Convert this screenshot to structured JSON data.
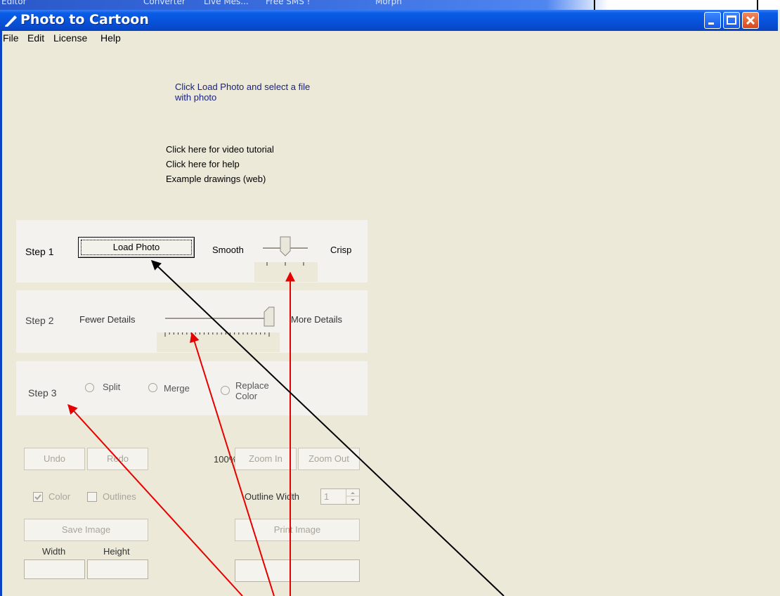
{
  "taskbar": {
    "items": [
      "Editor",
      "Converter",
      "Live Mes...",
      "Free SMS !",
      "Morph"
    ]
  },
  "window": {
    "title": "Photo to Cartoon",
    "menu": [
      "File",
      "Edit",
      "License",
      "Help"
    ]
  },
  "instructions": {
    "load_hint_line1": "Click Load Photo and select a file",
    "load_hint_line2": "with photo",
    "video_link": "Click here for video tutorial",
    "help_link": "Click here for help",
    "examples_link": "Example drawings (web)"
  },
  "step1": {
    "label": "Step 1",
    "button": "Load Photo",
    "smooth_label": "Smooth",
    "crisp_label": "Crisp",
    "slider_value": 0.5
  },
  "step2": {
    "label": "Step 2",
    "fewer_label": "Fewer Details",
    "more_label": "More Details",
    "slider_value": 1.0
  },
  "step3": {
    "label": "Step 3",
    "options": [
      "Split",
      "Merge",
      "Replace Color"
    ]
  },
  "toolbar": {
    "undo": "Undo",
    "redo": "Redo",
    "zoom_level": "100%",
    "zoom_in": "Zoom In",
    "zoom_out": "Zoom Out",
    "color_checkbox": "Color",
    "outlines_checkbox": "Outlines",
    "outline_width_label": "Outline Width",
    "outline_width_value": "1",
    "save_image": "Save Image",
    "print_image": "Print Image",
    "width_label": "Width",
    "height_label": "Height"
  },
  "colors": {
    "titlebar": "#0851d8",
    "window_bg": "#ece9d8",
    "close_button": "#d8461c",
    "arrow_red": "#e60000",
    "arrow_black": "#000000"
  }
}
